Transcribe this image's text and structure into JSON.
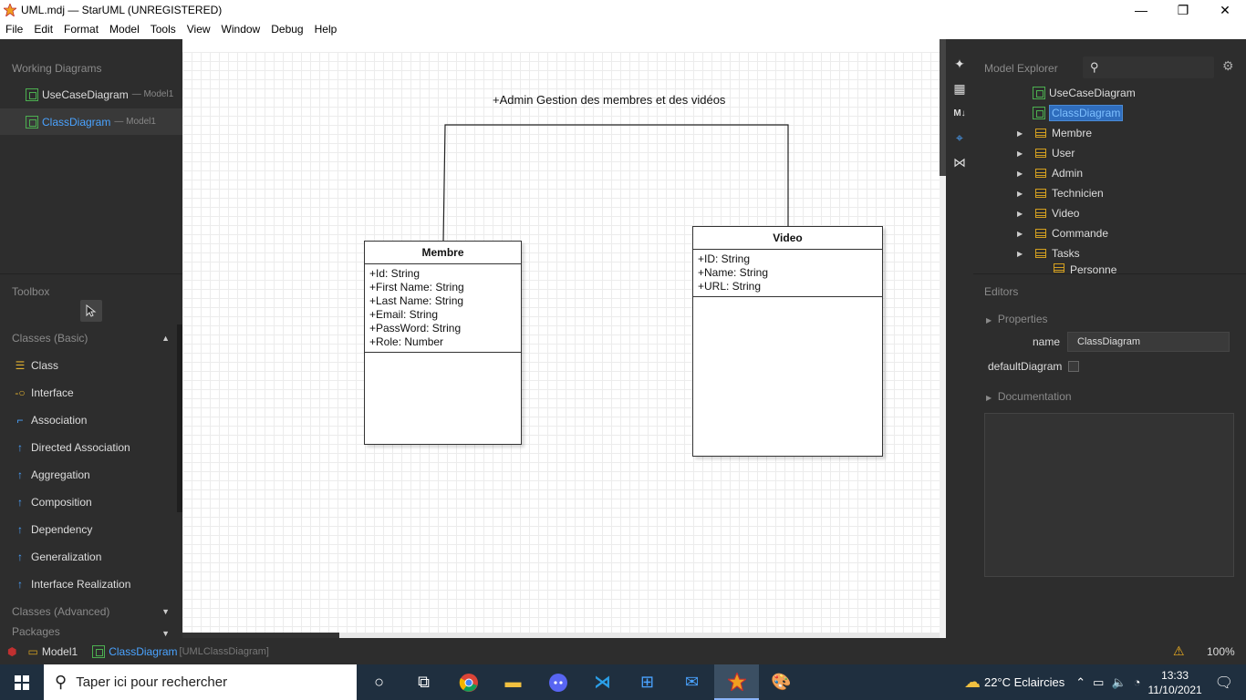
{
  "window": {
    "title": "UML.mdj — StarUML (UNREGISTERED)",
    "minimize_glyph": "—",
    "maximize_glyph": "❐",
    "close_glyph": "✕"
  },
  "menu": [
    "File",
    "Edit",
    "Format",
    "Model",
    "Tools",
    "View",
    "Window",
    "Debug",
    "Help"
  ],
  "working_diagrams": {
    "title": "Working Diagrams",
    "items": [
      {
        "label": "UseCaseDiagram",
        "sub": "— Model1"
      },
      {
        "label": "ClassDiagram",
        "sub": "— Model1"
      }
    ]
  },
  "toolbox": {
    "title": "Toolbox",
    "cat_basic": "Classes (Basic)",
    "cat_advanced": "Classes (Advanced)",
    "cat_packages": "Packages",
    "items": [
      "Class",
      "Interface",
      "Association",
      "Directed Association",
      "Aggregation",
      "Composition",
      "Dependency",
      "Generalization",
      "Interface Realization"
    ]
  },
  "diagram": {
    "note": "+Admin Gestion des membres et des vidéos",
    "membre": {
      "name": "Membre",
      "attributes": [
        "+Id: String",
        "+First Name: String",
        "+Last Name: String",
        "+Email: String",
        "+PassWord: String",
        "+Role: Number"
      ]
    },
    "video": {
      "name": "Video",
      "attributes": [
        "+ID: String",
        "+Name: String",
        "+URL: String"
      ]
    }
  },
  "model_explorer": {
    "title": "Model Explorer",
    "diagrams": [
      "UseCaseDiagram",
      "ClassDiagram"
    ],
    "classes": [
      "Membre",
      "User",
      "Admin",
      "Technicien",
      "Video",
      "Commande",
      "Tasks",
      "Personne"
    ]
  },
  "editors": {
    "title": "Editors",
    "properties": "Properties",
    "name_label": "name",
    "name_value": "ClassDiagram",
    "default_label": "defaultDiagram",
    "documentation": "Documentation"
  },
  "status": {
    "model": "Model1",
    "diagram": "ClassDiagram",
    "diagram_type": "[UMLClassDiagram]",
    "zoom": "100%"
  },
  "taskbar": {
    "search_placeholder": "Taper ici pour rechercher",
    "weather": "22°C Eclaircies",
    "time": "13:33",
    "date": "11/10/2021"
  }
}
